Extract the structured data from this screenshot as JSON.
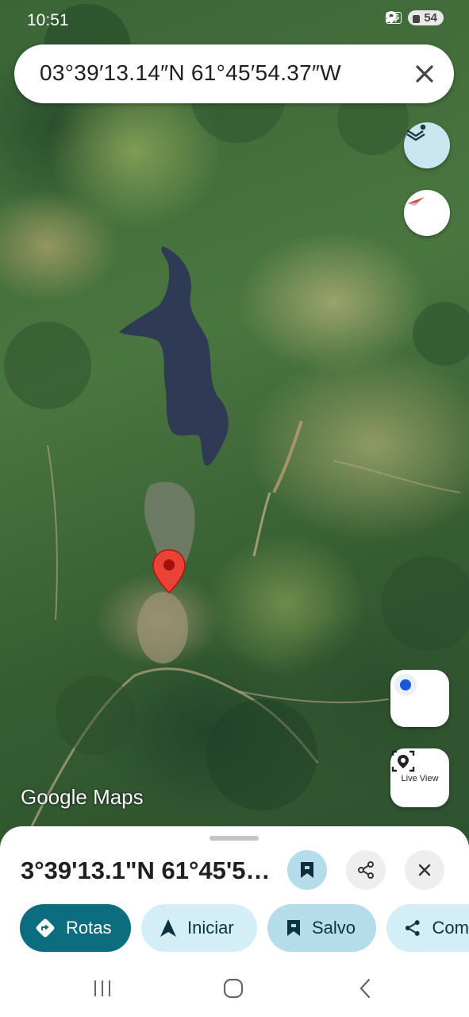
{
  "status_bar": {
    "time": "10:51",
    "network": "5G",
    "battery": "54",
    "icons": [
      "location-icon",
      "signal-icon",
      "battery-icon"
    ]
  },
  "search": {
    "query": "03°39′13.14″N 61°45′54.37″W",
    "clear_icon": "close-icon"
  },
  "map": {
    "attribution": "Google Maps",
    "layers_icon": "layers-icon",
    "compass_icon": "compass-icon",
    "my_location_icon": "my-location-icon",
    "live_view_label": "Live View",
    "pin_color": "#ea4335"
  },
  "place_sheet": {
    "title": "3°39'13.1\"N 61°45'5…",
    "actions": {
      "save_icon": "bookmark-icon",
      "share_icon": "share-icon",
      "close_icon": "close-icon"
    },
    "chips": [
      {
        "label": "Rotas",
        "icon": "directions-icon"
      },
      {
        "label": "Iniciar",
        "icon": "navigation-arrow-icon"
      },
      {
        "label": "Salvo",
        "icon": "bookmark-icon"
      },
      {
        "label": "Com",
        "icon": "share-icon"
      }
    ]
  },
  "colors": {
    "primary_chip": "#0b6d7e",
    "secondary_chip": "#d3eef6",
    "saved_chip": "#b5dcea",
    "accent_blue": "#1a56db"
  }
}
